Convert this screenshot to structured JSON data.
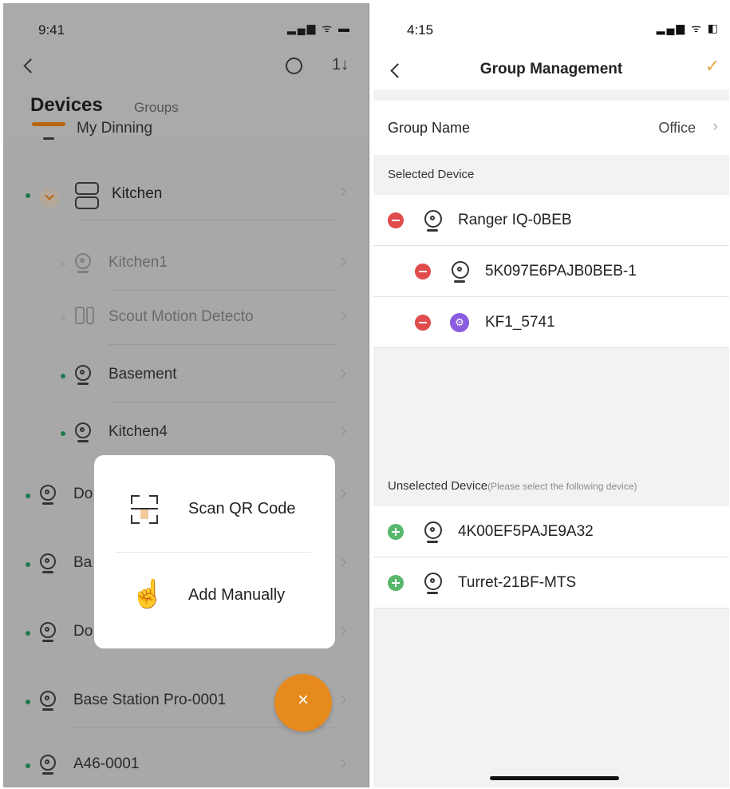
{
  "left": {
    "status_time": "9:41",
    "status_icons": "▂▄▆ ᯤ ▬",
    "sort_icon": "1↓",
    "tabs": {
      "active": "Devices",
      "inactive": "Groups"
    },
    "partial_row": "My Dinning",
    "group_row": "Kitchen",
    "children": [
      "Kitchen1",
      "Scout Motion Detecto",
      "Basement",
      "Kitchen4"
    ],
    "rows": [
      "Do",
      "Ba",
      "Do",
      "Base Station Pro-0001",
      "A46-0001"
    ],
    "popup": {
      "scan": "Scan QR Code",
      "manual": "Add Manually"
    },
    "fab_icon": "×",
    "hand_icon": "☝"
  },
  "right": {
    "status_time": "4:15",
    "status_icons": "▂▄▆ ᯤ ◧",
    "title": "Group Management",
    "confirm_icon": "✓",
    "group_name_label": "Group Name",
    "group_name_value": "Office",
    "selected_header": "Selected Device",
    "selected": [
      "Ranger IQ-0BEB",
      "5K097E6PAJB0BEB-1",
      "KF1_5741"
    ],
    "unselected_header": "Unselected Device",
    "unselected_hint": "(Please select the following device)",
    "unselected": [
      "4K00EF5PAJE9A32",
      "Turret-21BF-MTS"
    ],
    "chevron": "›"
  },
  "colors": {
    "accent": "#e68a1e",
    "remove": "#e04b4b",
    "add": "#57b86c"
  }
}
